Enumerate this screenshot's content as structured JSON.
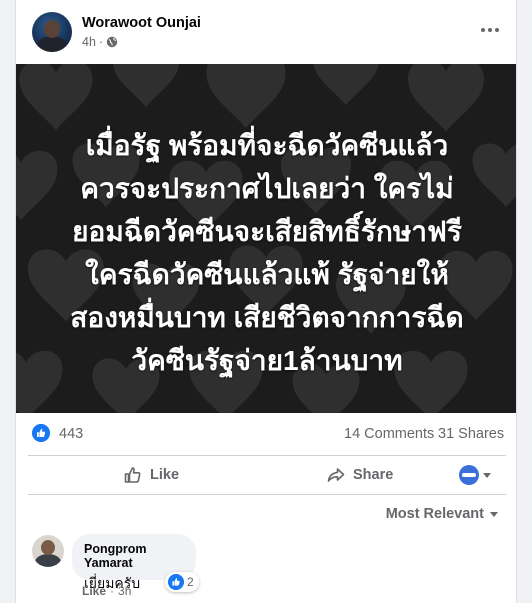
{
  "post": {
    "author": "Worawoot Ounjai",
    "time": "4h",
    "separator": "·",
    "audience_icon": "globe-icon"
  },
  "image": {
    "lines": [
      "เมื่อรัฐ พร้อมที่จะฉีดวัคซีนแล้ว",
      "ควรจะประกาศไปเลยว่า ใครไม่",
      "ยอมฉีดวัคซีนจะเสียสิทธิ์รักษาฟรี",
      "ใครฉีดวัคซีนแล้วแพ้ รัฐจ่ายให้",
      "สองหมื่นบาท เสียชีวิตจากการฉีด",
      "วัคซีนรัฐจ่าย1ล้านบาท"
    ],
    "background_color": "#1c1c1c",
    "heart_color": "#3a3a3a"
  },
  "stats": {
    "likes": "443",
    "comments": "14 Comments",
    "shares": "31 Shares"
  },
  "actions": {
    "like": "Like",
    "share": "Share"
  },
  "comments": {
    "sort_label": "Most Relevant",
    "items": [
      {
        "name": "Pongprom Yamarat",
        "text": "เยี่ยมครับ",
        "reactions": "2",
        "like_label": "Like",
        "separator": "·",
        "time": "3h"
      }
    ]
  },
  "colors": {
    "brand_blue": "#1877f2",
    "secondary_text": "#65676b"
  }
}
